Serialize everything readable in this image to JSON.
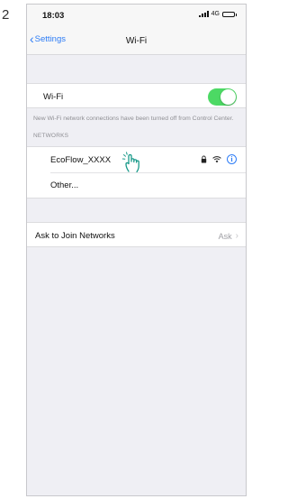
{
  "step_number": "2",
  "status_bar": {
    "time": "18:03",
    "network": "4G"
  },
  "nav": {
    "back_label": "Settings",
    "title": "Wi-Fi"
  },
  "wifi_toggle": {
    "label": "Wi-Fi",
    "on": true,
    "note": "New Wi-Fi network connections have been turned off from Control Center."
  },
  "networks": {
    "header": "NETWORKS",
    "items": [
      {
        "name": "EcoFlow_XXXX",
        "locked": true
      }
    ],
    "other_label": "Other..."
  },
  "ask_to_join": {
    "label": "Ask to Join Networks",
    "value": "Ask"
  },
  "colors": {
    "accent": "#2d7cf6",
    "toggle_on": "#4cd964",
    "hand": "#1a9a8a"
  },
  "icons": [
    "chevron-left-icon",
    "lock-icon",
    "wifi-icon",
    "info-icon",
    "pointing-hand-icon",
    "chevron-right-icon"
  ]
}
